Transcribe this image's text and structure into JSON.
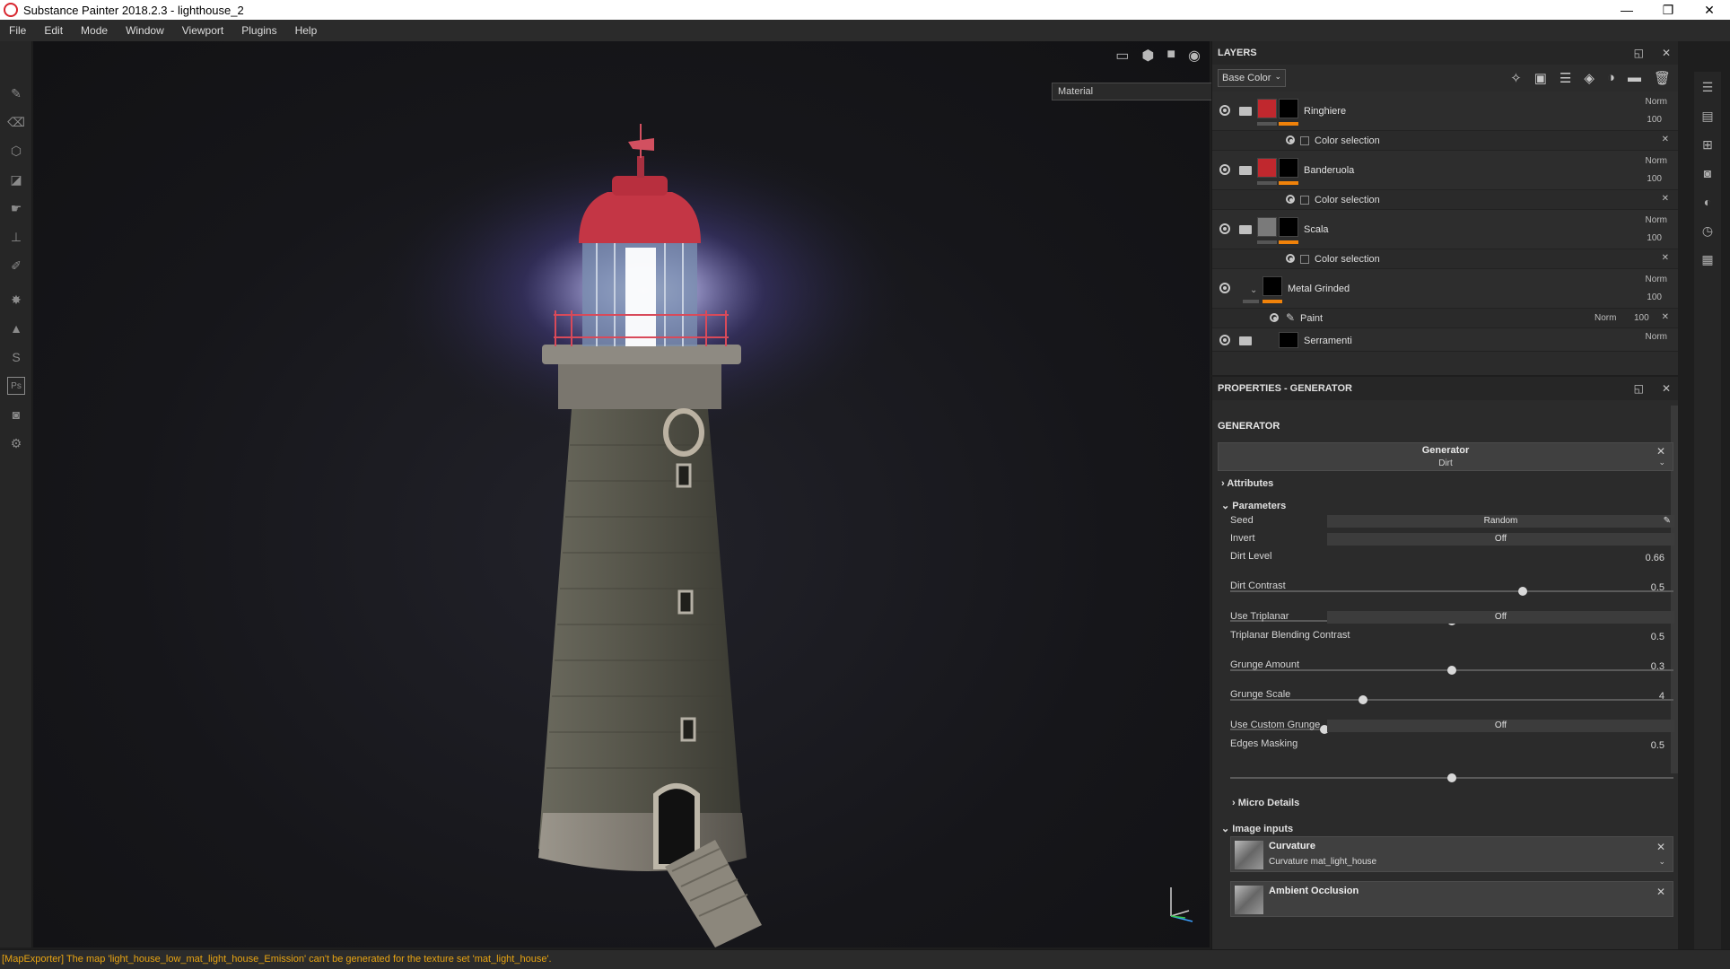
{
  "window": {
    "title": "Substance Painter 2018.2.3 - lighthouse_2",
    "min": "—",
    "max": "❐",
    "close": "✕"
  },
  "menu": [
    "File",
    "Edit",
    "Mode",
    "Window",
    "Viewport",
    "Plugins",
    "Help"
  ],
  "viewport": {
    "mode_select": "Material"
  },
  "layers": {
    "title": "LAYERS",
    "channel": "Base Color",
    "items": [
      {
        "name": "Ringhiere",
        "blend": "Norm",
        "opacity": "100",
        "mask_label": "Color selection",
        "swatch": "#c0282e"
      },
      {
        "name": "Banderuola",
        "blend": "Norm",
        "opacity": "100",
        "mask_label": "Color selection",
        "swatch": "#c0282e"
      },
      {
        "name": "Scala",
        "blend": "Norm",
        "opacity": "100",
        "mask_label": "Color selection",
        "swatch": "#7a7a7a"
      },
      {
        "name": "Metal Grinded",
        "blend": "Norm",
        "opacity": "100",
        "paint_label": "Paint",
        "paint_blend": "Norm",
        "paint_opacity": "100"
      },
      {
        "name": "Serramenti",
        "blend": "Norm"
      }
    ]
  },
  "properties": {
    "title": "PROPERTIES - GENERATOR",
    "section": "GENERATOR",
    "generator_title": "Generator",
    "generator_value": "Dirt",
    "attributes": "Attributes",
    "parameters": "Parameters",
    "seed": {
      "label": "Seed",
      "value": "Random"
    },
    "invert": {
      "label": "Invert",
      "value": "Off"
    },
    "dirt_level": {
      "label": "Dirt Level",
      "value": "0.66",
      "fraction": 0.66
    },
    "dirt_contrast": {
      "label": "Dirt Contrast",
      "value": "0.5",
      "fraction": 0.5
    },
    "use_triplanar": {
      "label": "Use Triplanar",
      "value": "Off"
    },
    "triplanar_contrast": {
      "label": "Triplanar Blending Contrast",
      "value": "0.5",
      "fraction": 0.5
    },
    "grunge_amount": {
      "label": "Grunge Amount",
      "value": "0.3",
      "fraction": 0.3
    },
    "grunge_scale": {
      "label": "Grunge Scale",
      "value": "4"
    },
    "use_custom_grunge": {
      "label": "Use Custom Grunge",
      "value": "Off"
    },
    "edges_masking": {
      "label": "Edges Masking",
      "value": "0.5",
      "fraction": 0.5
    },
    "micro_details": "Micro Details",
    "image_inputs": "Image inputs",
    "curvature_title": "Curvature",
    "curvature_value": "Curvature mat_light_house",
    "ao_title": "Ambient Occlusion"
  },
  "status": "[MapExporter] The map 'light_house_low_mat_light_house_Emission' can't be generated for the texture set 'mat_light_house'."
}
